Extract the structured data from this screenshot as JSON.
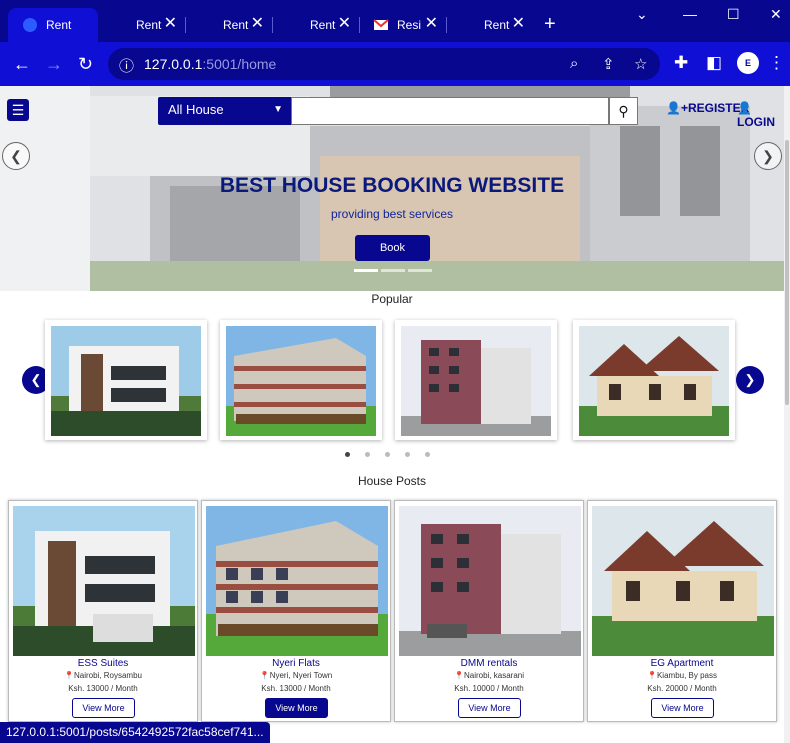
{
  "browser": {
    "tabs": [
      {
        "title": "Rent",
        "icon": "globe-icon"
      },
      {
        "title": "Rent",
        "icon": "globe-icon"
      },
      {
        "title": "Rent",
        "icon": "globe-icon"
      },
      {
        "title": "Rent",
        "icon": "globe-icon"
      },
      {
        "title": "Resi",
        "icon": "gmail-icon"
      },
      {
        "title": "Rent",
        "icon": "globe-icon"
      }
    ],
    "url_host": "127.0.0.1",
    "url_path": ":5001/home",
    "status_url": "127.0.0.1:5001/posts/6542492572fac58cef741...",
    "accent_color": "#07078f"
  },
  "header": {
    "search_category": "All House",
    "search_placeholder": "",
    "register_label": "REGISTER",
    "login_label": "LOGIN"
  },
  "hero": {
    "title": "BEST HOUSE BOOKING WEBSITE",
    "subtitle": "providing best services",
    "book_label": "Book",
    "active_slide": 1,
    "slide_count": 3
  },
  "popular": {
    "heading": "Popular",
    "active_dot": 1,
    "dot_count": 5
  },
  "posts": {
    "heading": "House Posts",
    "items": [
      {
        "name": "ESS Suites",
        "location": "Nairobi, Roysambu",
        "price": "Ksh. 13000 / Month",
        "button": "View More"
      },
      {
        "name": "Nyeri Flats",
        "location": "Nyeri, Nyeri Town",
        "price": "Ksh. 13000 / Month",
        "button": "View More"
      },
      {
        "name": "DMM rentals",
        "location": "Nairobi, kasarani",
        "price": "Ksh. 10000 / Month",
        "button": "View More"
      },
      {
        "name": "EG Apartment",
        "location": "Kiambu, By pass",
        "price": "Ksh. 20000 / Month",
        "button": "View More"
      }
    ]
  }
}
